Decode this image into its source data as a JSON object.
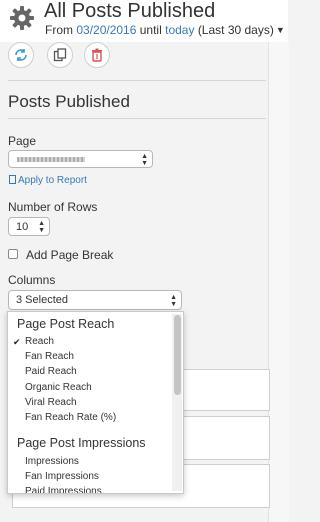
{
  "header": {
    "title": "All Posts Published",
    "from_label": "From",
    "from_date": "03/20/2016",
    "until_label": "until",
    "until_value": "today",
    "range_label": "(Last 30 days)"
  },
  "toolbar": {
    "refresh_icon": "refresh-icon",
    "copy_icon": "copy-icon",
    "delete_icon": "trash-icon"
  },
  "section": {
    "title": "Posts Published"
  },
  "page_field": {
    "label": "Page",
    "apply_link": "Apply to Report"
  },
  "rows_field": {
    "label": "Number of Rows",
    "value": "10"
  },
  "page_break": {
    "label": "Add Page Break",
    "checked": false
  },
  "columns_field": {
    "label": "Columns",
    "value": "3 Selected"
  },
  "dropdown": {
    "groups": [
      {
        "title": "Page Post Reach",
        "items": [
          {
            "label": "Reach",
            "checked": true
          },
          {
            "label": "Fan Reach",
            "checked": false
          },
          {
            "label": "Paid Reach",
            "checked": false
          },
          {
            "label": "Organic Reach",
            "checked": false
          },
          {
            "label": "Viral Reach",
            "checked": false
          },
          {
            "label": "Fan Reach Rate (%)",
            "checked": false
          }
        ]
      },
      {
        "title": "Page Post Impressions",
        "items": [
          {
            "label": "Impressions",
            "checked": false
          },
          {
            "label": "Fan Impressions",
            "checked": false
          },
          {
            "label": "Paid Impressions",
            "checked": false
          }
        ]
      }
    ]
  },
  "colors": {
    "link": "#3a78b5",
    "danger": "#d9534f",
    "refresh": "#3a9bd8"
  }
}
